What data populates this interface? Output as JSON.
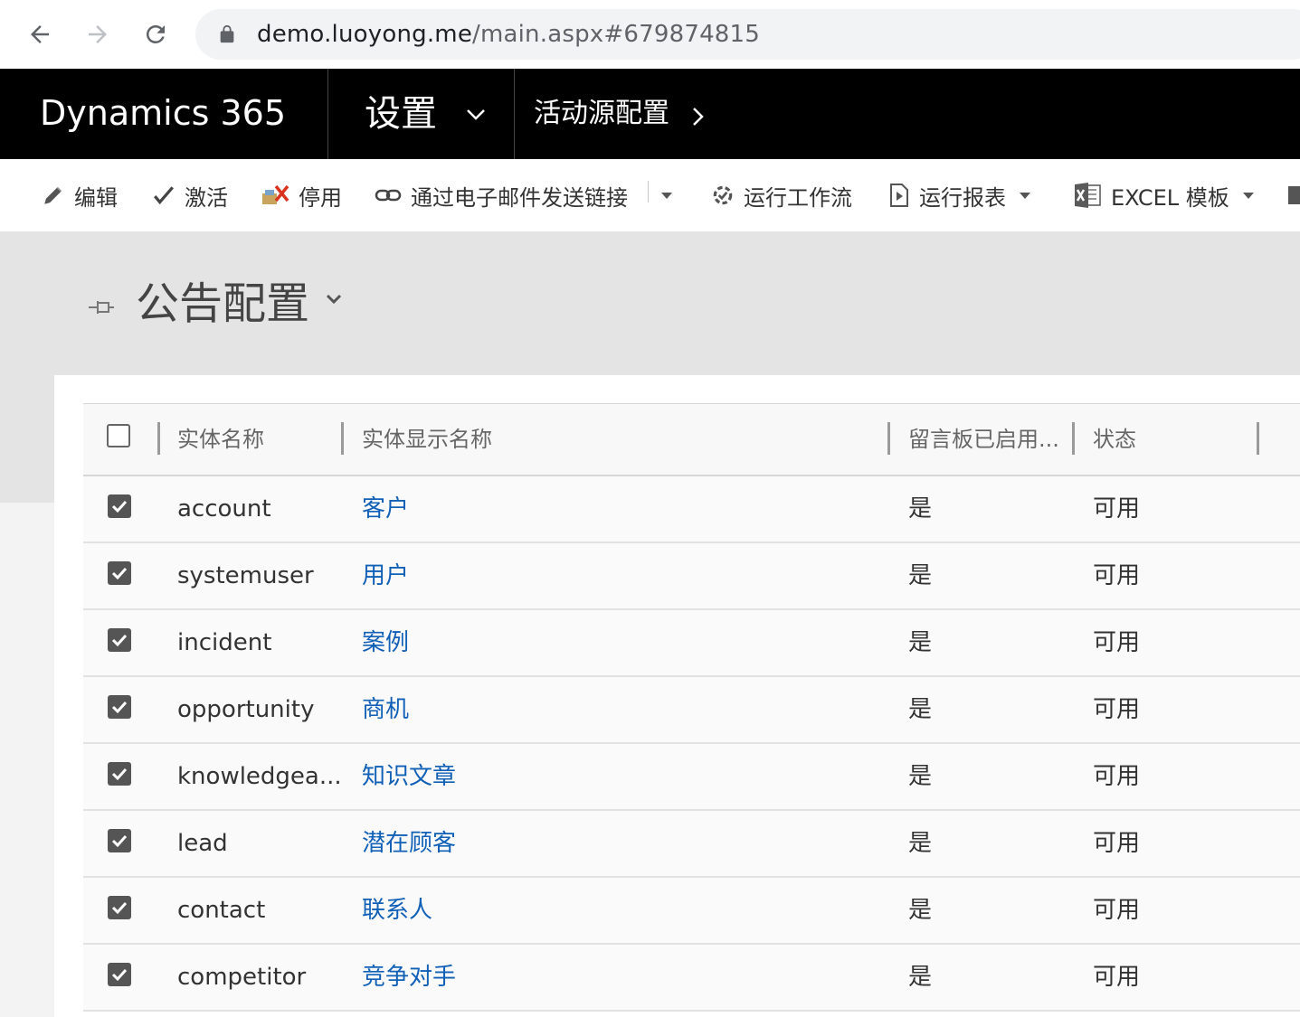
{
  "browser": {
    "url_host": "demo.luoyong.me",
    "url_path": "/main.aspx#679874815"
  },
  "nav": {
    "brand": "Dynamics 365",
    "area": "设置",
    "breadcrumb": "活动源配置"
  },
  "commands": [
    {
      "label": "编辑",
      "icon": "pencil-icon"
    },
    {
      "label": "激活",
      "icon": "check-icon"
    },
    {
      "label": "停用",
      "icon": "deactivate-icon"
    },
    {
      "label": "通过电子邮件发送链接",
      "icon": "link-icon"
    },
    {
      "label": "运行工作流",
      "icon": "workflow-icon"
    },
    {
      "label": "运行报表",
      "icon": "report-icon"
    },
    {
      "label": "EXCEL 模板",
      "icon": "excel-icon"
    }
  ],
  "page": {
    "title": "公告配置"
  },
  "grid": {
    "columns": [
      "实体名称",
      "实体显示名称",
      "留言板已启用...",
      "状态"
    ],
    "rows": [
      {
        "name": "account",
        "display": "客户",
        "enabled": "是",
        "status": "可用"
      },
      {
        "name": "systemuser",
        "display": "用户",
        "enabled": "是",
        "status": "可用"
      },
      {
        "name": "incident",
        "display": "案例",
        "enabled": "是",
        "status": "可用"
      },
      {
        "name": "opportunity",
        "display": "商机",
        "enabled": "是",
        "status": "可用"
      },
      {
        "name": "knowledgea...",
        "display": "知识文章",
        "enabled": "是",
        "status": "可用"
      },
      {
        "name": "lead",
        "display": "潜在顾客",
        "enabled": "是",
        "status": "可用"
      },
      {
        "name": "contact",
        "display": "联系人",
        "enabled": "是",
        "status": "可用"
      },
      {
        "name": "competitor",
        "display": "竞争对手",
        "enabled": "是",
        "status": "可用"
      }
    ]
  },
  "colors": {
    "nav_bg": "#000000",
    "link": "#1160b7",
    "header_band": "#e4e4e4"
  }
}
